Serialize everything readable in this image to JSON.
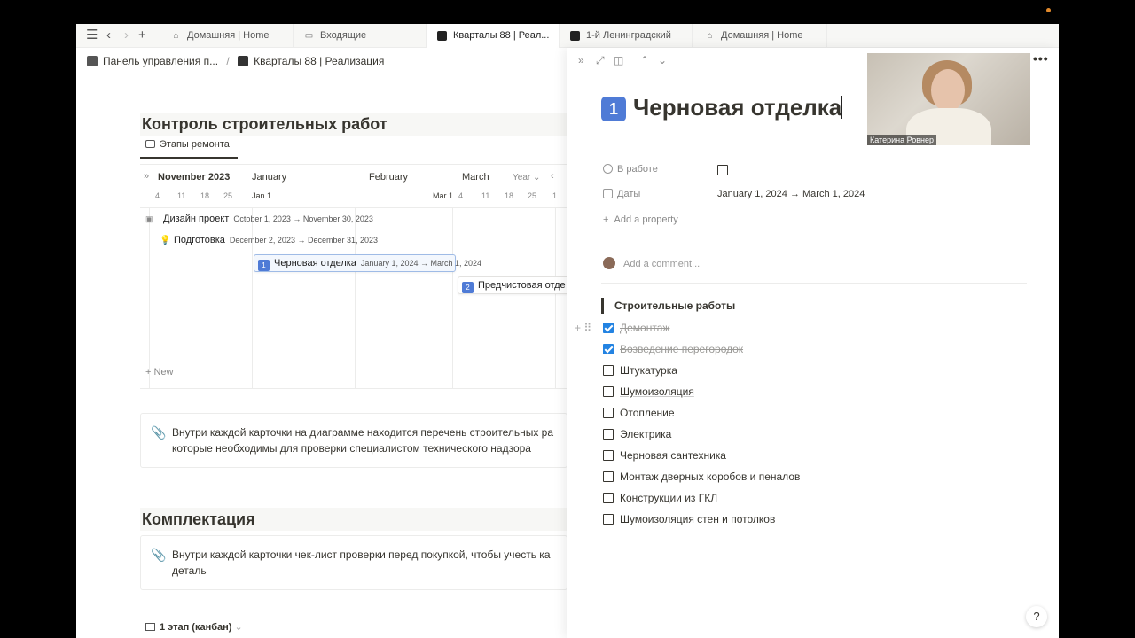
{
  "tabs": [
    {
      "label": "Домашняя | Home",
      "icon": "home-icon"
    },
    {
      "label": "Входящие",
      "icon": "inbox-icon"
    },
    {
      "label": "Кварталы 88 | Реал...",
      "icon": "page-icon"
    },
    {
      "label": "1-й Ленинградский",
      "icon": "page-icon"
    },
    {
      "label": "Домашняя | Home",
      "icon": "home-icon"
    }
  ],
  "breadcrumb": {
    "parent": "Панель управления п...",
    "current": "Кварталы 88 | Реализация",
    "sep": "/"
  },
  "section1": {
    "title": "Контроль строительных работ",
    "view_tab": "Этапы ремонта"
  },
  "timeline": {
    "months": [
      "November 2023",
      "January",
      "February",
      "March"
    ],
    "scale": "Year",
    "days": [
      "4",
      "11",
      "18",
      "25",
      "Jan 1",
      "Mar 1",
      "4",
      "11",
      "18",
      "25",
      "1"
    ],
    "items": [
      {
        "name": "Дизайн проект",
        "dates": "October 1, 2023 → November 30, 2023"
      },
      {
        "name": "Подготовка",
        "dates": "December 2, 2023 → December 31, 2023"
      },
      {
        "name": "Черновая отделка",
        "dates": "January 1, 2024 → March 1, 2024"
      },
      {
        "name": "Предчистовая отде"
      }
    ],
    "new_label": "New"
  },
  "callout1": {
    "line1": "Внутри каждой карточки на диаграмме находится перечень строительных ра",
    "line2": "которые необходимы для проверки специалистом технического надзора"
  },
  "section2": {
    "title": "Комплектация"
  },
  "callout2": {
    "line1": "Внутри каждой карточки чек-лист проверки перед покупкой, чтобы учесть ка",
    "line2": "деталь"
  },
  "kanban": {
    "label": "1 этап (канбан)"
  },
  "panel": {
    "title": "Черновая отделка",
    "title_num": "1",
    "props": [
      {
        "label": "В работе"
      },
      {
        "label": "Даты",
        "value": "January 1, 2024 → March 1, 2024"
      }
    ],
    "add_property": "Add a property",
    "comment_placeholder": "Add a comment...",
    "section": "Строительные работы",
    "todos": [
      {
        "text": "Демонтаж",
        "done": true
      },
      {
        "text": "Возведение перегородок",
        "done": true
      },
      {
        "text": "Штукатурка",
        "done": false
      },
      {
        "text": "Шумоизоляция",
        "done": false
      },
      {
        "text": "Отопление",
        "done": false
      },
      {
        "text": "Электрика",
        "done": false
      },
      {
        "text": "Черновая сантехника",
        "done": false
      },
      {
        "text": "Монтаж дверных коробов и пеналов",
        "done": false
      },
      {
        "text": "Конструкции из ГКЛ",
        "done": false
      },
      {
        "text": "Шумоизоляция стен и потолков",
        "done": false
      }
    ]
  },
  "video": {
    "name": "Катерина Ровнер"
  },
  "help": "?"
}
